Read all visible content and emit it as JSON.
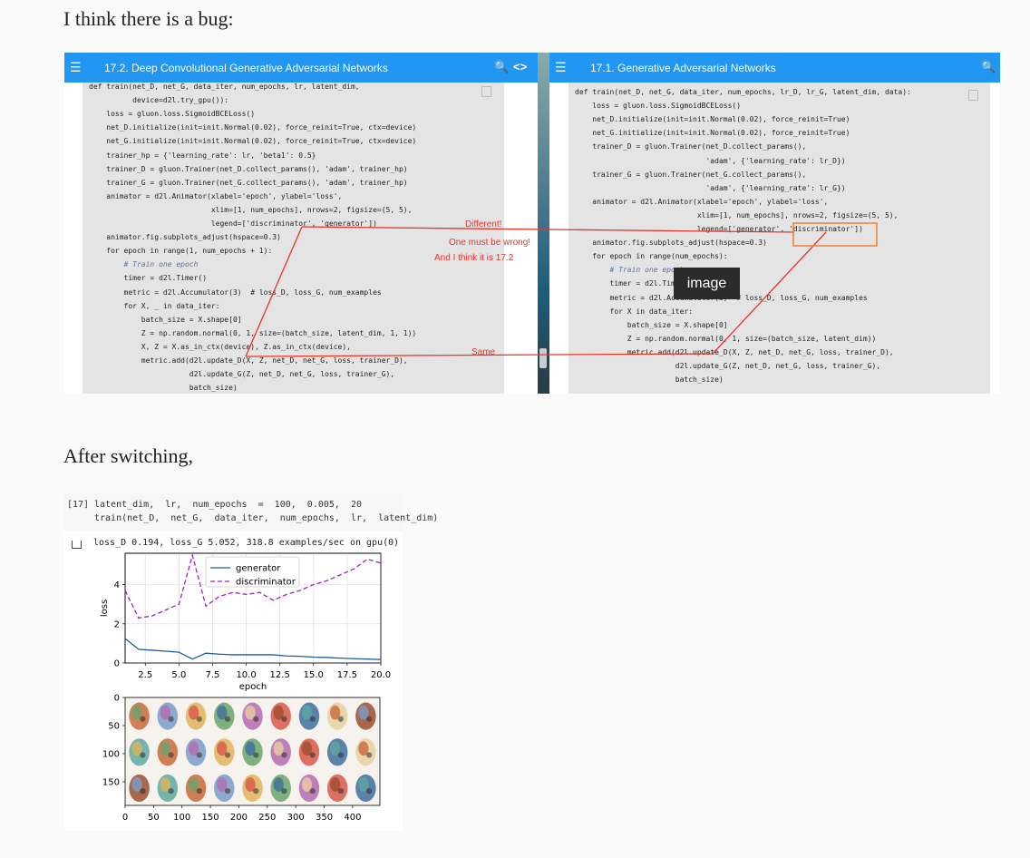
{
  "post": {
    "intro": "I think there is a bug:",
    "after": "After switching,"
  },
  "left_pane": {
    "title": "17.2. Deep Convolutional Generative Adversarial Networks",
    "code_lines": [
      "def train(net_D, net_G, data_iter, num_epochs, lr, latent_dim,",
      "          device=d2l.try_gpu()):",
      "    loss = gluon.loss.SigmoidBCELoss()",
      "    net_D.initialize(init=init.Normal(0.02), force_reinit=True, ctx=device)",
      "    net_G.initialize(init=init.Normal(0.02), force_reinit=True, ctx=device)",
      "    trainer_hp = {'learning_rate': lr, 'beta1': 0.5}",
      "    trainer_D = gluon.Trainer(net_D.collect_params(), 'adam', trainer_hp)",
      "    trainer_G = gluon.Trainer(net_G.collect_params(), 'adam', trainer_hp)",
      "    animator = d2l.Animator(xlabel='epoch', ylabel='loss',",
      "                            xlim=[1, num_epochs], nrows=2, figsize=(5, 5),",
      "                            legend=['discriminator', 'generator'])",
      "    animator.fig.subplots_adjust(hspace=0.3)",
      "    for epoch in range(1, num_epochs + 1):",
      "        # Train one epoch",
      "        timer = d2l.Timer()",
      "        metric = d2l.Accumulator(3)  # loss_D, loss_G, num_examples",
      "        for X, _ in data_iter:",
      "            batch_size = X.shape[0]",
      "            Z = np.random.normal(0, 1, size=(batch_size, latent_dim, 1, 1))",
      "            X, Z = X.as_in_ctx(device), Z.as_in_ctx(device),",
      "            metric.add(d2l.update_D(X, Z, net_D, net_G, loss, trainer_D),",
      "                       d2l.update_G(Z, net_D, net_G, loss, trainer_G),",
      "                       batch_size)"
    ]
  },
  "right_pane": {
    "title": "17.1. Generative Adversarial Networks",
    "code_lines": [
      "def train(net_D, net_G, data_iter, num_epochs, lr_D, lr_G, latent_dim, data):",
      "    loss = gluon.loss.SigmoidBCELoss()",
      "    net_D.initialize(init=init.Normal(0.02), force_reinit=True)",
      "    net_G.initialize(init=init.Normal(0.02), force_reinit=True)",
      "    trainer_D = gluon.Trainer(net_D.collect_params(),",
      "                              'adam', {'learning_rate': lr_D})",
      "    trainer_G = gluon.Trainer(net_G.collect_params(),",
      "                              'adam', {'learning_rate': lr_G})",
      "    animator = d2l.Animator(xlabel='epoch', ylabel='loss',",
      "                            xlim=[1, num_epochs], nrows=2, figsize=(5, 5),",
      "                            legend=['generator', 'discriminator'])",
      "    animator.fig.subplots_adjust(hspace=0.3)",
      "    for epoch in range(num_epochs):",
      "        # Train one epoch",
      "        timer = d2l.Timer()",
      "        metric = d2l.Accumulator(3)  # loss_D, loss_G, num_examples",
      "        for X in data_iter:",
      "            batch_size = X.shape[0]",
      "            Z = np.random.normal(0, 1, size=(batch_size, latent_dim))",
      "            metric.add(d2l.update_D(X, Z, net_D, net_G, loss, trainer_D),",
      "                       d2l.update_G(Z, net_D, net_G, loss, trainer_G),",
      "                       batch_size)"
    ]
  },
  "annotations": {
    "different": "Different!",
    "wrong": "One must be wrong!",
    "think": "And I think it is 17.2",
    "same": "Same",
    "image_tag": "image"
  },
  "colors": {
    "topbar": "#2196f3",
    "annotation": "#e8332a",
    "highlight_box": "#f08030"
  },
  "notebook": {
    "prompt": "[17]",
    "line1": "latent_dim,  lr,  num_epochs  =  100,  0.005,  20",
    "line2": "train(net_D,  net_G,  data_iter,  num_epochs,  lr,  latent_dim)",
    "output": "loss_D 0.194, loss_G 5.052, 318.8 examples/sec on gpu(0)"
  },
  "chart_data": [
    {
      "type": "line",
      "xlabel": "epoch",
      "ylabel": "loss",
      "xlim": [
        1,
        20
      ],
      "ylim": [
        0,
        5.6
      ],
      "xticks": [
        "2.5",
        "5.0",
        "7.5",
        "10.0",
        "12.5",
        "15.0",
        "17.5",
        "20.0"
      ],
      "yticks": [
        "0",
        "2",
        "4"
      ],
      "grid": true,
      "legend": "top-center",
      "series": [
        {
          "name": "generator",
          "style": "solid",
          "color": "#1f5d99",
          "x": [
            1,
            2,
            3,
            4,
            5,
            6,
            7,
            8,
            9,
            10,
            11,
            12,
            13,
            14,
            15,
            16,
            17,
            18,
            19,
            20
          ],
          "y": [
            1.25,
            0.7,
            0.65,
            0.6,
            0.55,
            0.2,
            0.5,
            0.45,
            0.42,
            0.42,
            0.42,
            0.42,
            0.36,
            0.34,
            0.3,
            0.28,
            0.25,
            0.22,
            0.2,
            0.18
          ]
        },
        {
          "name": "discriminator",
          "style": "dashed",
          "color": "#a020c0",
          "x": [
            1,
            2,
            3,
            4,
            5,
            6,
            7,
            8,
            9,
            10,
            11,
            12,
            13,
            14,
            15,
            16,
            17,
            18,
            19,
            20
          ],
          "y": [
            3.7,
            2.3,
            2.4,
            2.7,
            3.0,
            5.5,
            2.9,
            3.4,
            3.6,
            3.5,
            3.6,
            3.2,
            3.5,
            3.7,
            4.0,
            4.2,
            4.5,
            4.8,
            5.3,
            5.1
          ]
        }
      ]
    },
    {
      "type": "heatmap",
      "xticks": [
        "0",
        "50",
        "100",
        "150",
        "200",
        "250",
        "300",
        "350",
        "400"
      ],
      "yticks": [
        "0",
        "50",
        "100",
        "150"
      ],
      "xlim": [
        0,
        448
      ],
      "ylim": [
        0,
        192
      ]
    }
  ]
}
